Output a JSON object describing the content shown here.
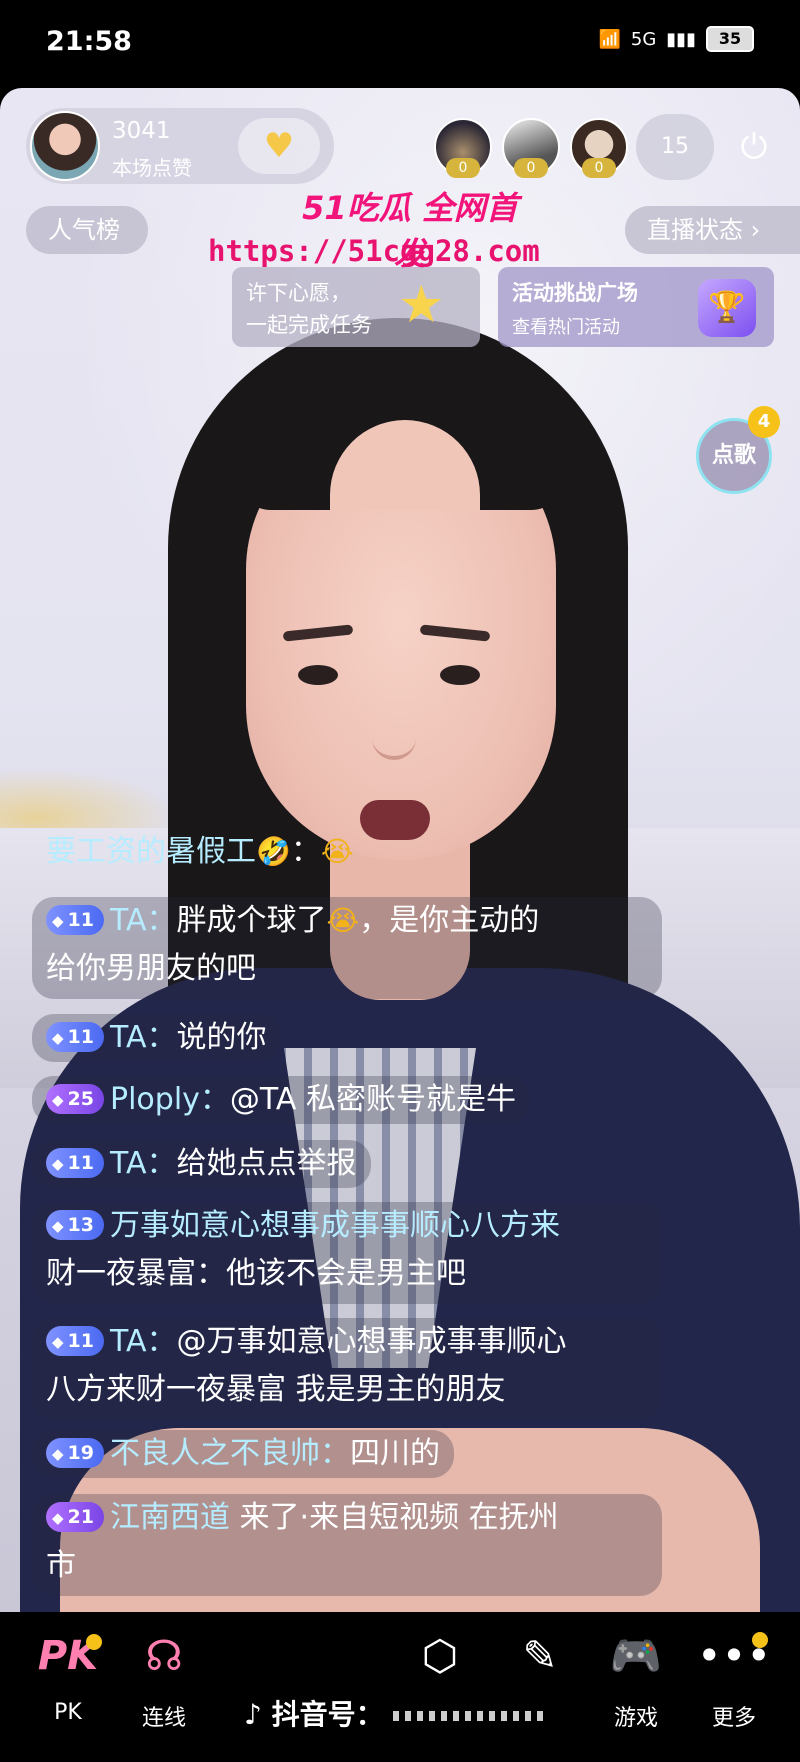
{
  "status_bar": {
    "time": "21:58",
    "network": "5G",
    "battery": "35"
  },
  "host": {
    "like_count": "3041",
    "like_label": "本场点赞"
  },
  "viewers": {
    "badges": [
      "0",
      "0",
      "0"
    ],
    "count": "15"
  },
  "chips": {
    "popularity": "人气榜",
    "live_status": "直播状态 ›"
  },
  "watermark": {
    "title": "51吃瓜 全网首发",
    "url": "https://51cgg28.com"
  },
  "task_cards": {
    "wish_line1": "许下心愿，",
    "wish_line2": "一起完成任务",
    "challenge_title": "活动挑战广场",
    "challenge_sub": "查看热门活动"
  },
  "song": {
    "label": "点歌",
    "badge": "4"
  },
  "chat": [
    {
      "level": "",
      "name": "要工资的暑假工",
      "text": "："
    },
    {
      "level": "11",
      "name": "TA：",
      "text": "胖成个球了",
      "text2": "，是你主动的",
      "line2": "给你男朋友的吧"
    },
    {
      "level": "11",
      "name": "TA：",
      "text": "说的你"
    },
    {
      "level": "25",
      "name": "Ploply：",
      "text": "@TA 私密账号就是牛"
    },
    {
      "level": "11",
      "name": "TA：",
      "text": "给她点点举报"
    },
    {
      "level": "13",
      "name": "万事如意心想事成事事顺心八方来",
      "line2": "财一夜暴富：他该不会是男主吧"
    },
    {
      "level": "11",
      "name": "TA：",
      "text": "@万事如意心想事成事事顺心",
      "line2": "八方来财一夜暴富 我是男主的朋友"
    },
    {
      "level": "19",
      "name": "不良人之不良帅：",
      "text": "四川的"
    },
    {
      "level": "21",
      "name": "江南西道",
      "text": " 来了·来自短视频 在抚州",
      "line2": "市"
    }
  ],
  "bottom_bar": {
    "pk_label": "PK",
    "link_label": "连线",
    "game_label": "游戏",
    "more_label": "更多",
    "douyin_label": "抖音号："
  }
}
